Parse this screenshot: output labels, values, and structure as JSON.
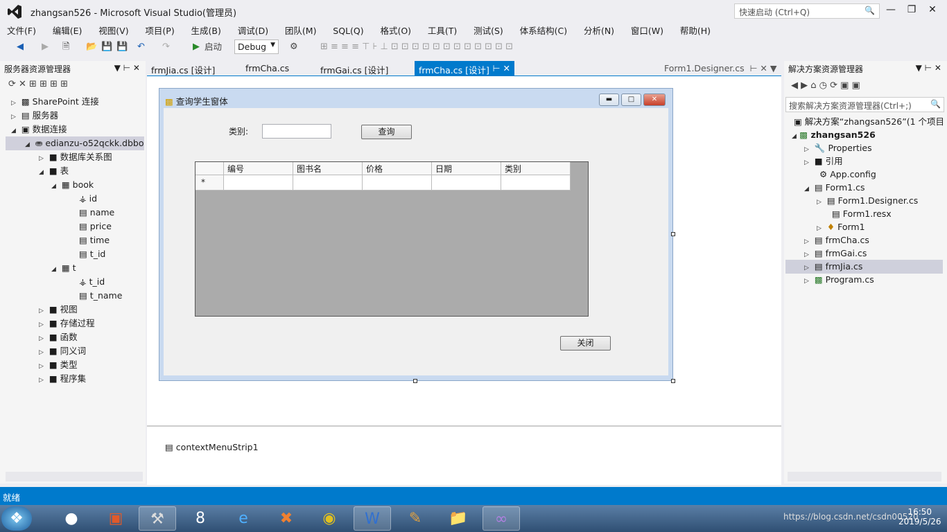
{
  "window": {
    "title": "zhangsan526 - Microsoft Visual Studio(管理员)",
    "quick_launch": "快速启动 (Ctrl+Q)"
  },
  "menu": [
    "文件(F)",
    "编辑(E)",
    "视图(V)",
    "项目(P)",
    "生成(B)",
    "调试(D)",
    "团队(M)",
    "SQL(Q)",
    "格式(O)",
    "工具(T)",
    "测试(S)",
    "体系结构(C)",
    "分析(N)",
    "窗口(W)",
    "帮助(H)"
  ],
  "toolbar": {
    "start_label": "启动",
    "config": "Debug"
  },
  "server_explorer": {
    "title": "服务器资源管理器",
    "items": [
      {
        "label": "SharePoint 连接",
        "level": 0
      },
      {
        "label": "服务器",
        "level": 0
      },
      {
        "label": "数据连接",
        "level": 0
      },
      {
        "label": "edianzu-o52qckk.dbbo",
        "level": 1
      },
      {
        "label": "数据库关系图",
        "level": 2
      },
      {
        "label": "表",
        "level": 2
      },
      {
        "label": "book",
        "level": 3
      },
      {
        "label": "id",
        "level": 4
      },
      {
        "label": "name",
        "level": 4
      },
      {
        "label": "price",
        "level": 4
      },
      {
        "label": "time",
        "level": 4
      },
      {
        "label": "t_id",
        "level": 4
      },
      {
        "label": "t",
        "level": 3
      },
      {
        "label": "t_id",
        "level": 4
      },
      {
        "label": "t_name",
        "level": 4
      },
      {
        "label": "视图",
        "level": 2
      },
      {
        "label": "存储过程",
        "level": 2
      },
      {
        "label": "函数",
        "level": 2
      },
      {
        "label": "同义词",
        "level": 2
      },
      {
        "label": "类型",
        "level": 2
      },
      {
        "label": "程序集",
        "level": 2
      }
    ]
  },
  "tabs": [
    "frmJia.cs [设计]",
    "frmCha.cs",
    "frmGai.cs [设计]",
    "frmCha.cs [设计]",
    "Form1.Designer.cs"
  ],
  "form": {
    "title": "查询学生窗体",
    "category_label": "类别:",
    "query_button": "查询",
    "close_button": "关闭",
    "grid_columns": [
      "编号",
      "图书名",
      "价格",
      "日期",
      "类别"
    ],
    "new_row_marker": "*"
  },
  "component_tray": {
    "item": "contextMenuStrip1"
  },
  "solution_explorer": {
    "title": "解决方案资源管理器",
    "search_placeholder": "搜索解决方案资源管理器(Ctrl+;)",
    "items": [
      {
        "label": "解决方案“zhangsan526”(1 个项目",
        "level": 0
      },
      {
        "label": "zhangsan526",
        "level": 1
      },
      {
        "label": "Properties",
        "level": 2
      },
      {
        "label": "引用",
        "level": 2
      },
      {
        "label": "App.config",
        "level": 2
      },
      {
        "label": "Form1.cs",
        "level": 2
      },
      {
        "label": "Form1.Designer.cs",
        "level": 3
      },
      {
        "label": "Form1.resx",
        "level": 3
      },
      {
        "label": "Form1",
        "level": 3
      },
      {
        "label": "frmCha.cs",
        "level": 2
      },
      {
        "label": "frmGai.cs",
        "level": 2
      },
      {
        "label": "frmJia.cs",
        "level": 2
      },
      {
        "label": "Program.cs",
        "level": 2
      }
    ]
  },
  "status": {
    "text": "就绪"
  },
  "taskbar": {
    "time": "16:50",
    "date": "2019/5/26",
    "watermark": "https://blog.csdn.net/csdn00520"
  },
  "colors": {
    "accent": "#007acc",
    "vs_purple": "#68217a"
  }
}
